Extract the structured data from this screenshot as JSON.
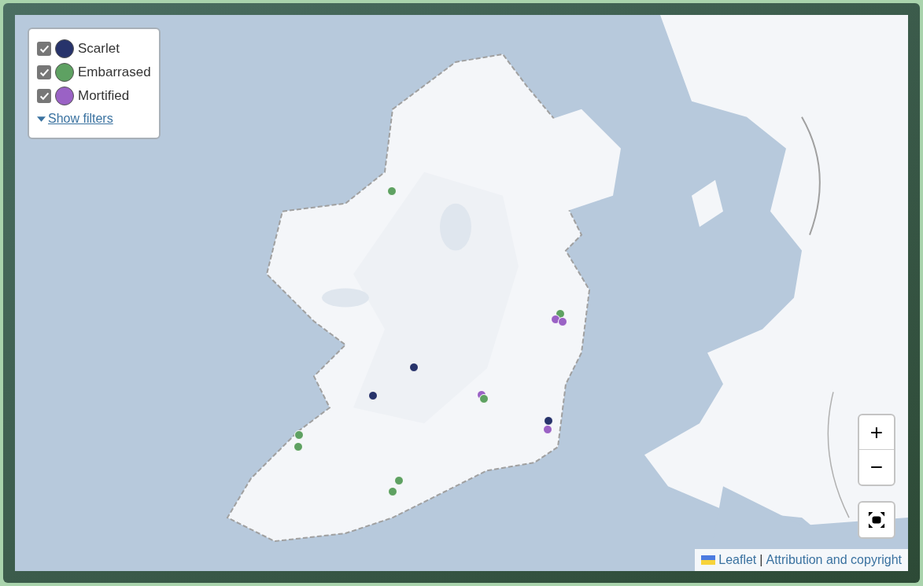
{
  "legend": {
    "layers": [
      {
        "label": "Scarlet",
        "checked": true,
        "color": "#27336b"
      },
      {
        "label": "Embarrased",
        "checked": true,
        "color": "#5ea162"
      },
      {
        "label": "Mortified",
        "checked": true,
        "color": "#9a62c5"
      }
    ],
    "filters_link": "Show filters",
    "filters_expanded": false
  },
  "zoom": {
    "in": "+",
    "out": "−"
  },
  "attribution": {
    "leaflet": "Leaflet",
    "separator": "|",
    "credits": "Attribution and copyright"
  }
}
